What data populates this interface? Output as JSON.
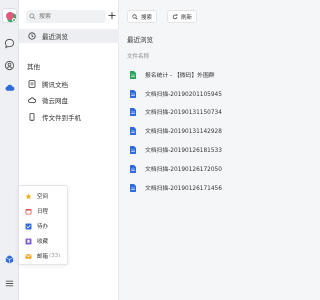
{
  "colors": {
    "accent": "#2f6bdc",
    "sheet_green": "#2aa55d",
    "doc_blue": "#2f6bdc"
  },
  "rail": {
    "icons": [
      "chat-bubble-icon",
      "contacts-icon",
      "cloud-drive-icon",
      "apps-cube-icon",
      "menu-icon"
    ]
  },
  "sidebar": {
    "search_placeholder": "搜索",
    "add_label": "+",
    "recent_label": "最近浏览",
    "section_title": "其他",
    "items": [
      {
        "label": "腾讯文档",
        "icon": "tencent-docs-icon"
      },
      {
        "label": "微云网盘",
        "icon": "weiyun-icon"
      },
      {
        "label": "传文件到手机",
        "icon": "phone-icon"
      }
    ]
  },
  "popup": {
    "items": [
      {
        "label": "空间",
        "icon": "star-icon",
        "count": ""
      },
      {
        "label": "日程",
        "icon": "calendar-icon",
        "count": ""
      },
      {
        "label": "待办",
        "icon": "todo-icon",
        "count": ""
      },
      {
        "label": "收藏",
        "icon": "bookmark-icon",
        "count": ""
      },
      {
        "label": "邮箱",
        "icon": "mail-icon",
        "count": "(33)"
      }
    ]
  },
  "main": {
    "search_button": "搜索",
    "refresh_button": "刷新",
    "title": "最近浏览",
    "column_header": "文件名称",
    "files": [
      {
        "name": "报名统计 - 【微码】外围群",
        "type": "sheet"
      },
      {
        "name": "文档扫描-20190201105945",
        "type": "doc"
      },
      {
        "name": "文档扫描-20190131150734",
        "type": "doc"
      },
      {
        "name": "文档扫描-20190131142928",
        "type": "doc"
      },
      {
        "name": "文档扫描-20190126181533",
        "type": "doc"
      },
      {
        "name": "文档扫描-20190126172050",
        "type": "doc"
      },
      {
        "name": "文档扫描-20190126171456",
        "type": "doc"
      }
    ]
  }
}
